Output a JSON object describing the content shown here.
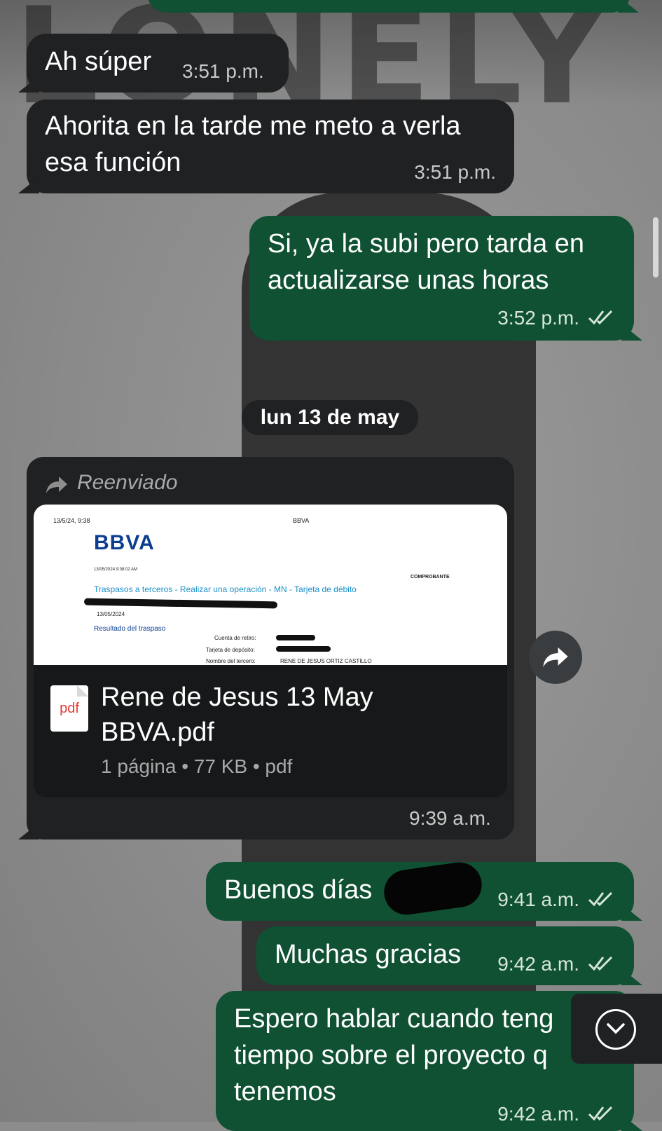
{
  "messages": {
    "m1": {
      "text": "Ah súper",
      "time": "3:51 p.m."
    },
    "m2": {
      "text": "Ahorita en la tarde me meto a verla esa función",
      "time": "3:51 p.m."
    },
    "m3": {
      "text": "Si, ya la subi pero tarda en actualizarse unas horas",
      "time": "3:52 p.m."
    },
    "date_separator": "lun 13 de may",
    "m4": {
      "forwarded_label": "Reenviado",
      "preview": {
        "date": "13/5/24, 9:38",
        "header_center": "BBVA",
        "logo": "BBVA",
        "timestamp": "13/05/2024 9:38:02 AM",
        "comprobante": "COMPROBANTE",
        "operation": "Traspasos a terceros - Realizar una operación - MN - Tarjeta de débito",
        "date2": "13/05/2024",
        "result_title": "Resultado del traspaso",
        "field1": "Cuenta de retiro:",
        "field2": "Tarjeta de depósito:",
        "field3": "Nombre del tercero:",
        "field3_value": "RENE DE JESUS ORTIZ CASTILLO"
      },
      "file_icon_label": "pdf",
      "file_name": "Rene de Jesus 13 May BBVA.pdf",
      "file_meta": "1 página • 77 KB • pdf",
      "time": "9:39 a.m."
    },
    "m5": {
      "text": "Buenos días",
      "time": "9:41 a.m."
    },
    "m6": {
      "text": "Muchas gracias",
      "time": "9:42 a.m."
    },
    "m7": {
      "text": "Espero hablar cuando teng tiempo sobre el proyecto q tenemos",
      "time": "9:42 a.m."
    }
  },
  "icons": {
    "forward": "forward-arrow-icon",
    "read_receipt": "double-check-icon",
    "scroll_down": "chevron-down-circle-icon"
  },
  "colors": {
    "incoming_bubble": "#1f2123",
    "outgoing_bubble": "#0f5132",
    "pdf_red": "#e53935",
    "bbva_blue": "#0b3d91"
  }
}
